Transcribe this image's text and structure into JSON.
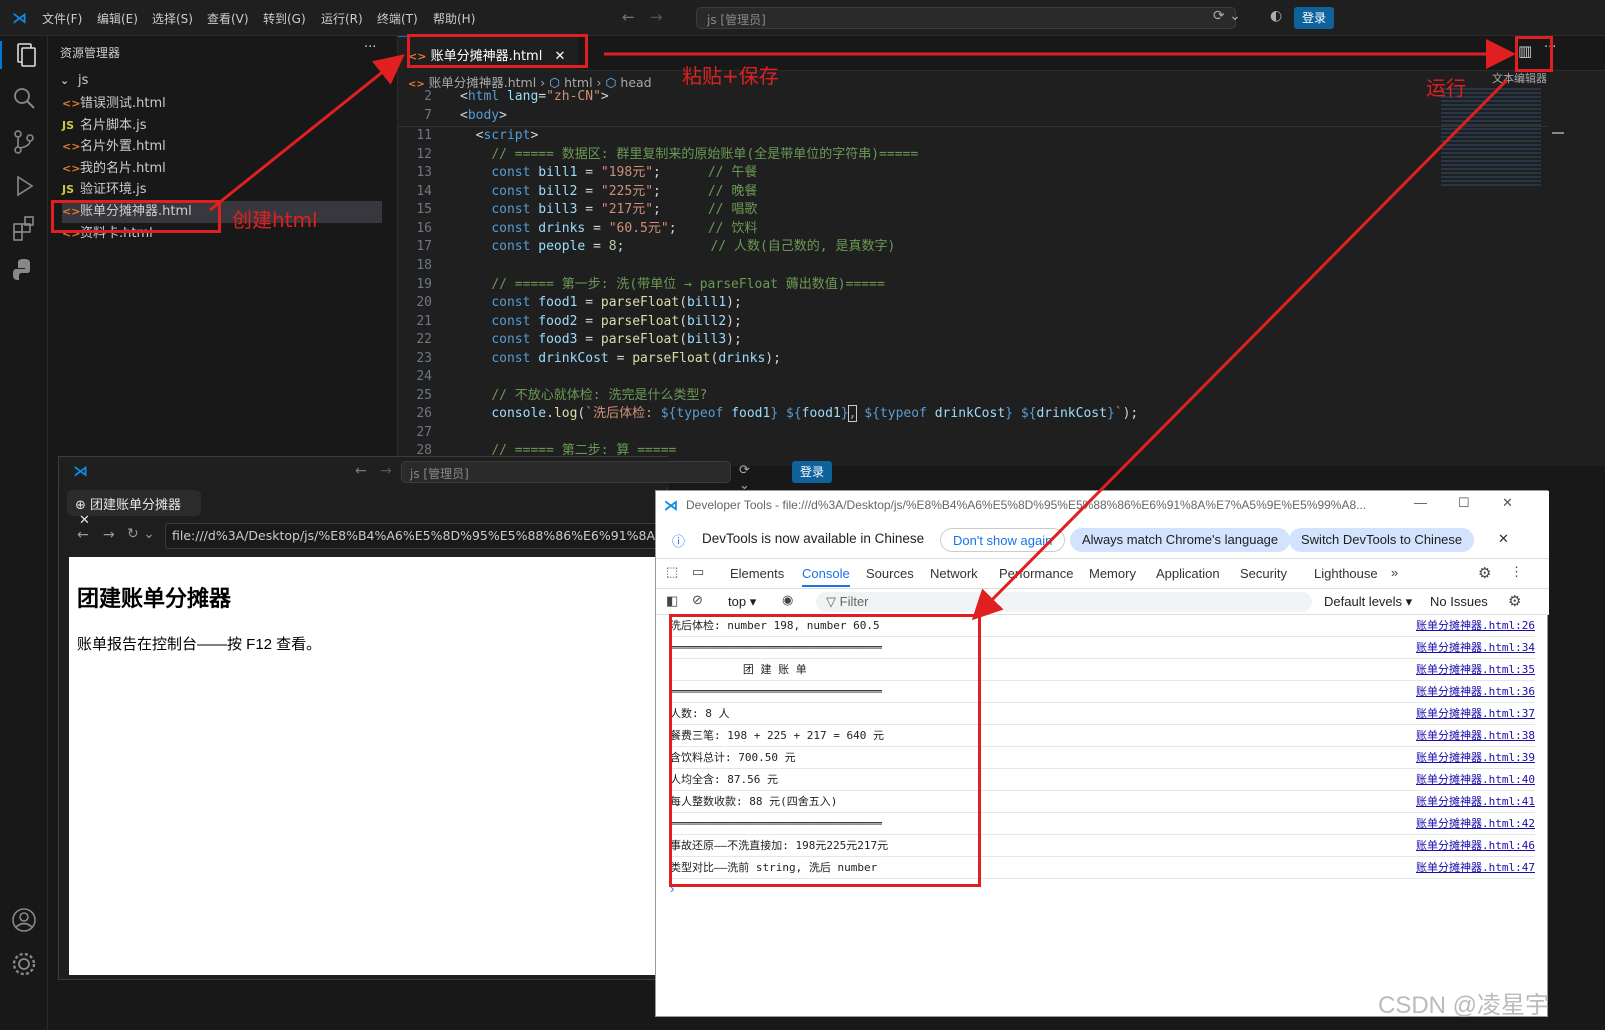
{
  "titlebar": {
    "menu": [
      "文件(F)",
      "编辑(E)",
      "选择(S)",
      "查看(V)",
      "转到(G)",
      "运行(R)",
      "终端(T)",
      "帮助(H)"
    ],
    "command_center": "js [管理员]",
    "login": "登录"
  },
  "sidebar": {
    "title": "资源管理器",
    "folder": "js",
    "items": [
      {
        "type": "html",
        "name": "错误测试.html"
      },
      {
        "type": "js",
        "name": "名片脚本.js"
      },
      {
        "type": "html",
        "name": "名片外置.html"
      },
      {
        "type": "html",
        "name": "我的名片.html"
      },
      {
        "type": "js",
        "name": "验证环境.js"
      },
      {
        "type": "html",
        "name": "账单分摊神器.html",
        "selected": true
      },
      {
        "type": "html",
        "name": "资料卡.html"
      }
    ]
  },
  "editor": {
    "tab": "账单分摊神器.html",
    "breadcrumb": [
      "账单分摊神器.html",
      "html",
      "head"
    ],
    "editor_mode": "文本编辑器"
  },
  "annotations": {
    "create": "创建html",
    "paste": "粘贴+保存",
    "run": "运行"
  },
  "browser": {
    "command_center": "js [管理员]",
    "login": "登录",
    "tab": "团建账单分摊器",
    "url": "file:///d%3A/Desktop/js/%E8%B4%A6%E5%8D%95%E5%88%86%E6%91%8A%E7%A5%9E%E5%99%A8",
    "heading": "团建账单分摊器",
    "text": "账单报告在控制台——按 F12 查看。"
  },
  "devtools": {
    "title": "Developer Tools - file:///d%3A/Desktop/js/%E8%B4%A6%E5%8D%95%E5%88%86%E6%91%8A%E7%A5%9E%E5%99%A8...",
    "banner": "DevTools is now available in Chinese",
    "btn_dont_show": "Don't show again",
    "btn_match": "Always match Chrome's language",
    "btn_switch": "Switch DevTools to Chinese",
    "tabs": [
      "Elements",
      "Console",
      "Sources",
      "Network",
      "Performance",
      "Memory",
      "Application",
      "Security",
      "Lighthouse"
    ],
    "context": "top",
    "filter": "Filter",
    "levels": "Default levels ▾",
    "issues": "No Issues",
    "logs": [
      {
        "text": "洗后体检: number 198, number 60.5",
        "src": "账单分摊神器.html:26"
      },
      {
        "text": "════════════════════════════════",
        "src": "账单分摊神器.html:34"
      },
      {
        "text": "           团 建 账 单",
        "src": "账单分摊神器.html:35"
      },
      {
        "text": "════════════════════════════════",
        "src": "账单分摊神器.html:36"
      },
      {
        "text": "人数: 8 人",
        "src": "账单分摊神器.html:37"
      },
      {
        "text": "餐费三笔: 198 + 225 + 217 = 640 元",
        "src": "账单分摊神器.html:38"
      },
      {
        "text": "含饮料总计: 700.50 元",
        "src": "账单分摊神器.html:39"
      },
      {
        "text": "人均全含: 87.56 元",
        "src": "账单分摊神器.html:40"
      },
      {
        "text": "每人整数收款: 88 元(四舍五入)",
        "src": "账单分摊神器.html:41"
      },
      {
        "text": "════════════════════════════════",
        "src": "账单分摊神器.html:42"
      },
      {
        "text": "事故还原——不洗直接加: 198元225元217元",
        "src": "账单分摊神器.html:46"
      },
      {
        "text": "类型对比——洗前 string, 洗后 number",
        "src": "账单分摊神器.html:47"
      }
    ]
  },
  "watermark": "CSDN @凌星宇"
}
